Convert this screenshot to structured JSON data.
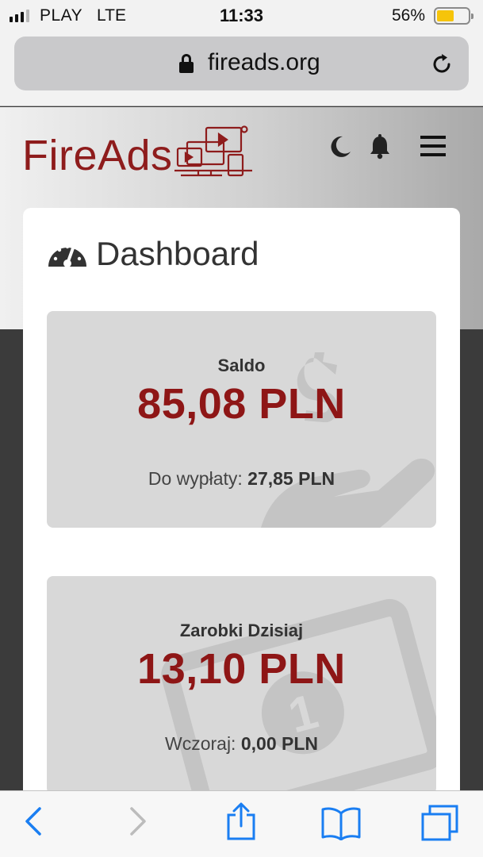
{
  "status_bar": {
    "carrier": "PLAY",
    "network": "LTE",
    "time": "11:33",
    "battery_percent": "56%",
    "battery_level": 0.56,
    "battery_color": "#f6c40a"
  },
  "browser": {
    "url": "fireads.org",
    "icons": [
      "lock-icon",
      "reload-icon"
    ]
  },
  "site": {
    "logo_text": "FireAds",
    "brand_color": "#8e1c1c",
    "header_icons": [
      "moon-icon",
      "bell-icon",
      "hamburger-menu-icon"
    ]
  },
  "dashboard": {
    "title": "Dashboard",
    "icon": "gauge-icon",
    "cards": [
      {
        "label": "Saldo",
        "value": "85,08 PLN",
        "sub_label": "Do wypłaty:",
        "sub_value": "27,85 PLN",
        "background_icon": "hand-dollar-icon"
      },
      {
        "label": "Zarobki Dzisiaj",
        "value": "13,10 PLN",
        "sub_label": "Wczoraj:",
        "sub_value": "0,00 PLN",
        "background_icon": "banknote-icon"
      }
    ]
  },
  "toolbar": {
    "icons": [
      "back-icon",
      "forward-icon",
      "share-icon",
      "bookmarks-icon",
      "tabs-icon"
    ],
    "accent_color": "#1a7ef2"
  }
}
